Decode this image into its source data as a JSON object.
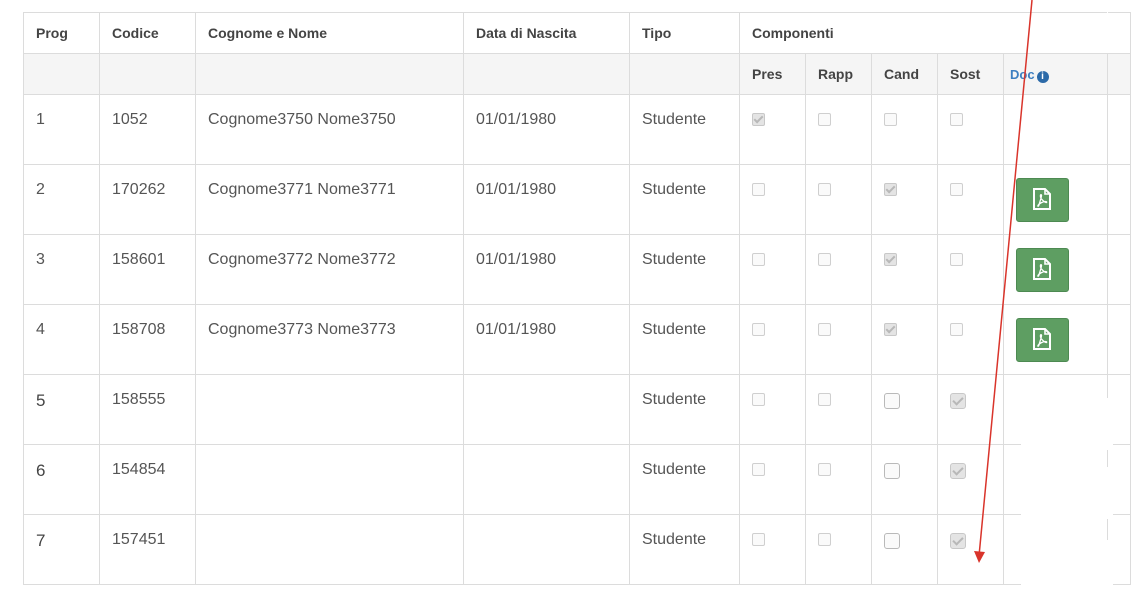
{
  "table": {
    "headers": {
      "prog": "Prog",
      "codice": "Codice",
      "cognome_nome": "Cognome e Nome",
      "data_nascita": "Data di Nascita",
      "tipo": "Tipo",
      "componenti": "Componenti"
    },
    "subheaders": {
      "pres": "Pres",
      "rapp": "Rapp",
      "cand": "Cand",
      "sost": "Sost",
      "doc": "Doc"
    },
    "rows": [
      {
        "prog": "1",
        "codice": "1052",
        "nome": "Cognome3750 Nome3750",
        "nascita": "01/01/1980",
        "tipo": "Studente",
        "pres": true,
        "rapp": false,
        "cand": false,
        "sost": false,
        "doc": false
      },
      {
        "prog": "2",
        "codice": "170262",
        "nome": "Cognome3771 Nome3771",
        "nascita": "01/01/1980",
        "tipo": "Studente",
        "pres": false,
        "rapp": false,
        "cand": true,
        "sost": false,
        "doc": true
      },
      {
        "prog": "3",
        "codice": "158601",
        "nome": "Cognome3772 Nome3772",
        "nascita": "01/01/1980",
        "tipo": "Studente",
        "pres": false,
        "rapp": false,
        "cand": true,
        "sost": false,
        "doc": true
      },
      {
        "prog": "4",
        "codice": "158708",
        "nome": "Cognome3773 Nome3773",
        "nascita": "01/01/1980",
        "tipo": "Studente",
        "pres": false,
        "rapp": false,
        "cand": true,
        "sost": false,
        "doc": true
      },
      {
        "prog": "5",
        "codice": "158555",
        "nome": "",
        "nascita": "",
        "tipo": "Studente",
        "pres": false,
        "rapp": false,
        "cand": false,
        "sost": true,
        "doc": false
      },
      {
        "prog": "6",
        "codice": "154854",
        "nome": "",
        "nascita": "",
        "tipo": "Studente",
        "pres": false,
        "rapp": false,
        "cand": false,
        "sost": true,
        "doc": false
      },
      {
        "prog": "7",
        "codice": "157451",
        "nome": "",
        "nascita": "",
        "tipo": "Studente",
        "pres": false,
        "rapp": false,
        "cand": false,
        "sost": true,
        "doc": false
      }
    ]
  },
  "icons": {
    "pdf": "pdf-icon",
    "info": "info-icon"
  },
  "colors": {
    "pdf_button": "#5e9e62",
    "doc_header": "#3d7fc1",
    "annotation_arrow": "#d9342b"
  }
}
